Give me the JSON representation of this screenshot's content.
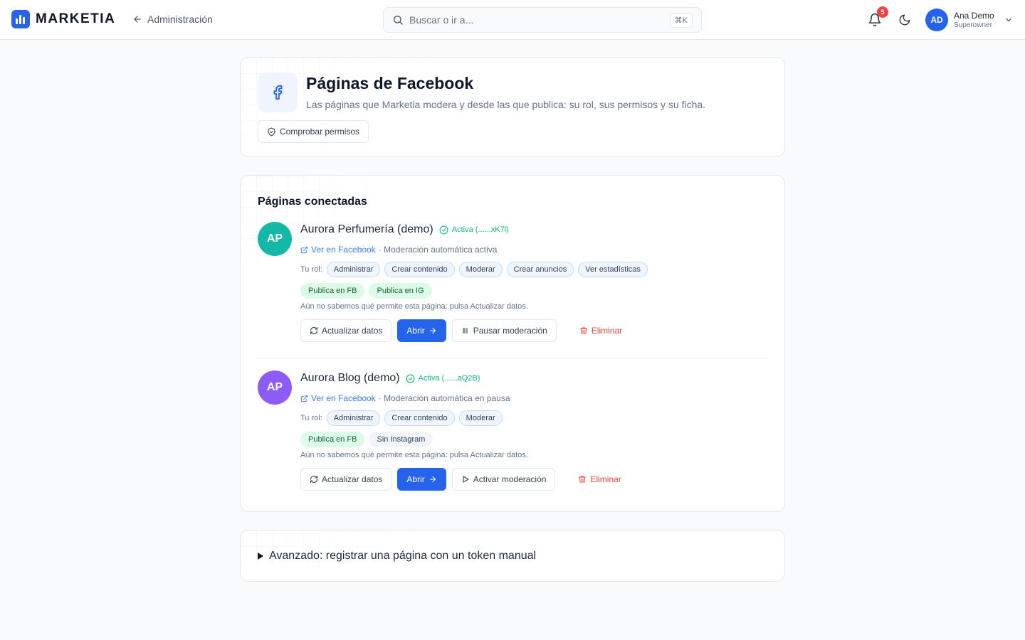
{
  "app": {
    "brand": "MARKETIA",
    "back_label": "Administración",
    "search_placeholder": "Buscar o ir a...",
    "search_shortcut": "⌘K",
    "notifications_count": "5",
    "user": {
      "initials": "AD",
      "name": "Ana Demo",
      "role": "Superowner"
    },
    "accent_color": "#2563eb"
  },
  "header_card": {
    "title": "Páginas de Facebook",
    "subtitle": "Las páginas que Marketia modera y desde las que publica: su rol, sus permisos y su ficha.",
    "check_permissions_label": "Comprobar permisos"
  },
  "pages_card": {
    "title": "Páginas conectadas",
    "role_label": "Tu rol:",
    "view_label": "Ver en Facebook",
    "update_label": "Actualizar datos",
    "open_label": "Abrir",
    "delete_label": "Eliminar",
    "items": [
      {
        "initials": "AP",
        "avatar_color": "#14b8a6",
        "name": "Aurora Perfumería (demo)",
        "status": "Activa (......xK7l)",
        "moderation_text": "· Moderación automática activa",
        "roles": [
          "Administrar",
          "Crear contenido",
          "Moderar",
          "Crear anuncios",
          "Ver estadísticas"
        ],
        "publish": [
          "Publica en FB",
          "Publica en IG"
        ],
        "note": "Aún no sabemos qué permite esta página: pulsa Actualizar datos.",
        "moderation_action": "Pausar moderación"
      },
      {
        "initials": "AP",
        "avatar_color": "#8b5cf6",
        "name": "Aurora Blog (demo)",
        "status": "Activa (......aQ2B)",
        "moderation_text": "· Moderación automática en pausa",
        "roles": [
          "Administrar",
          "Crear contenido",
          "Moderar"
        ],
        "publish": [
          "Publica en FB"
        ],
        "no_instagram": "Sin Instagram",
        "note": "Aún no sabemos qué permite esta página: pulsa Actualizar datos.",
        "moderation_action": "Activar moderación"
      }
    ]
  },
  "advanced_card": {
    "label": "Avanzado: registrar una página con un token manual"
  }
}
